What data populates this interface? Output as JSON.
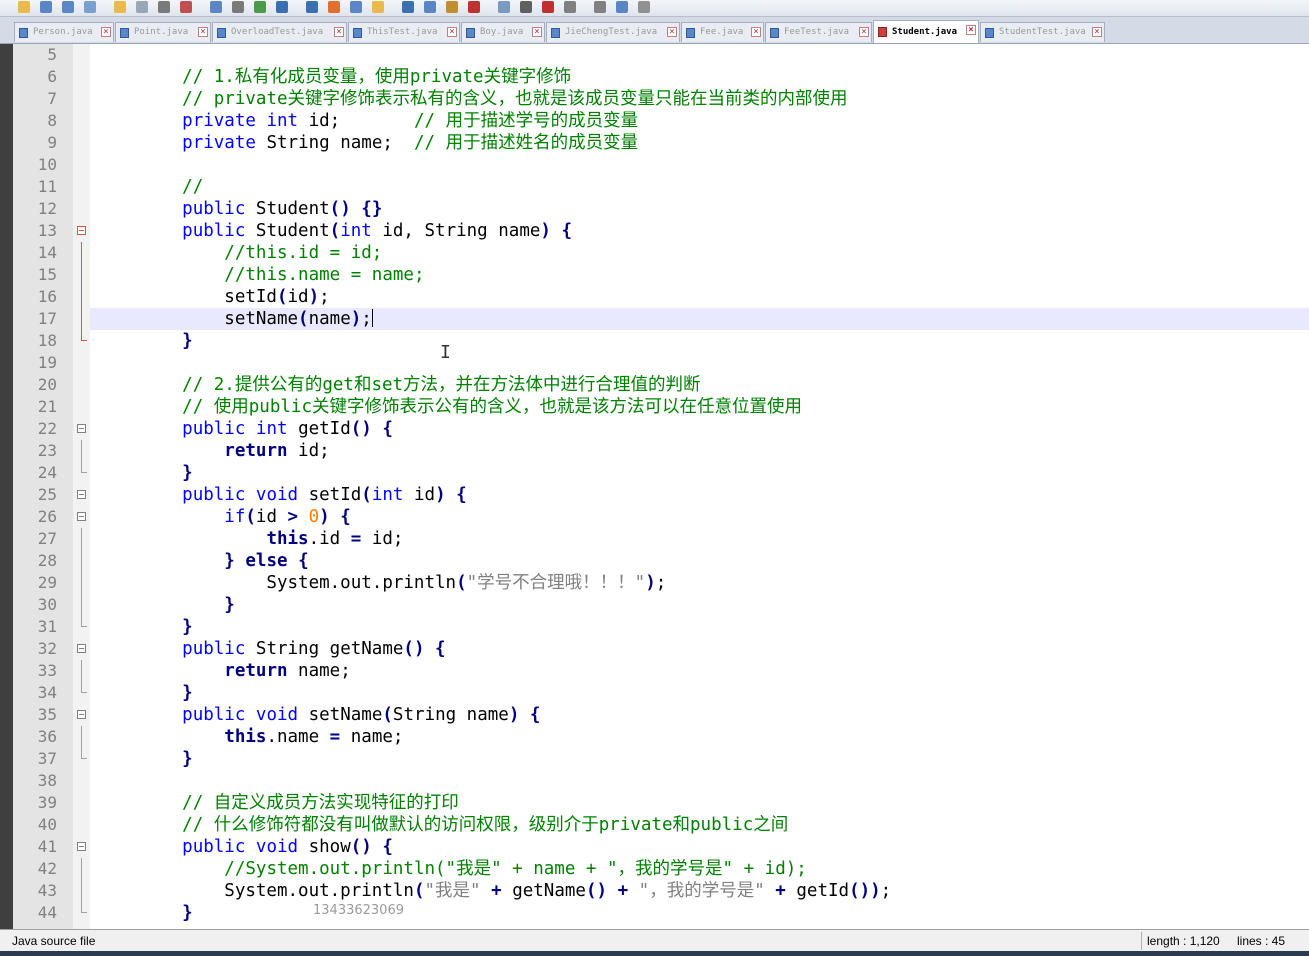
{
  "tabs": [
    {
      "label": "Person.java",
      "active": false
    },
    {
      "label": "Point.java",
      "active": false
    },
    {
      "label": "OverloadTest.java",
      "active": false
    },
    {
      "label": "ThisTest.java",
      "active": false
    },
    {
      "label": "Boy.java",
      "active": false
    },
    {
      "label": "JieChengTest.java",
      "active": false
    },
    {
      "label": "Fee.java",
      "active": false
    },
    {
      "label": "FeeTest.java",
      "active": false
    },
    {
      "label": "Student.java",
      "active": true
    },
    {
      "label": "StudentTest.java",
      "active": false
    }
  ],
  "editor": {
    "current_line": 17,
    "lines": [
      {
        "n": 5,
        "t": [
          [
            "",
            "    "
          ]
        ]
      },
      {
        "n": 6,
        "t": [
          [
            "",
            "    "
          ],
          [
            "c",
            "// 1.私有化成员变量，使用private关键字修饰"
          ]
        ]
      },
      {
        "n": 7,
        "t": [
          [
            "",
            "    "
          ],
          [
            "c",
            "// private关键字修饰表示私有的含义，也就是该成员变量只能在当前类的内部使用"
          ]
        ]
      },
      {
        "n": 8,
        "t": [
          [
            "",
            "    "
          ],
          [
            "k",
            "private"
          ],
          [
            "",
            " "
          ],
          [
            "k",
            "int"
          ],
          [
            "",
            " id;       "
          ],
          [
            "c",
            "// 用于描述学号的成员变量"
          ]
        ]
      },
      {
        "n": 9,
        "t": [
          [
            "",
            "    "
          ],
          [
            "k",
            "private"
          ],
          [
            "",
            " String name;  "
          ],
          [
            "c",
            "// 用于描述姓名的成员变量"
          ]
        ]
      },
      {
        "n": 10,
        "t": [
          [
            "",
            "    "
          ]
        ]
      },
      {
        "n": 11,
        "t": [
          [
            "",
            "    "
          ],
          [
            "c",
            "//"
          ]
        ]
      },
      {
        "n": 12,
        "t": [
          [
            "",
            "    "
          ],
          [
            "k",
            "public"
          ],
          [
            "",
            " Student"
          ],
          [
            "o",
            "()"
          ],
          [
            "",
            " "
          ],
          [
            "o",
            "{}"
          ]
        ]
      },
      {
        "n": 13,
        "t": [
          [
            "",
            "    "
          ],
          [
            "k",
            "public"
          ],
          [
            "",
            " Student"
          ],
          [
            "o",
            "("
          ],
          [
            "k",
            "int"
          ],
          [
            "",
            " id, String name"
          ],
          [
            "o",
            ")"
          ],
          [
            "",
            " "
          ],
          [
            "o",
            "{"
          ]
        ]
      },
      {
        "n": 14,
        "t": [
          [
            "",
            "        "
          ],
          [
            "c",
            "//this.id = id;"
          ]
        ]
      },
      {
        "n": 15,
        "t": [
          [
            "",
            "        "
          ],
          [
            "c",
            "//this.name = name;"
          ]
        ]
      },
      {
        "n": 16,
        "t": [
          [
            "",
            "        setId"
          ],
          [
            "o",
            "("
          ],
          [
            "",
            "id"
          ],
          [
            "o",
            ")"
          ],
          [
            "",
            ";"
          ]
        ]
      },
      {
        "n": 17,
        "t": [
          [
            "",
            "        setName"
          ],
          [
            "o",
            "("
          ],
          [
            "",
            "name"
          ],
          [
            "o",
            ")"
          ],
          [
            "",
            ";"
          ]
        ]
      },
      {
        "n": 18,
        "t": [
          [
            "",
            "    "
          ],
          [
            "o",
            "}"
          ]
        ]
      },
      {
        "n": 19,
        "t": [
          [
            "",
            "    "
          ]
        ]
      },
      {
        "n": 20,
        "t": [
          [
            "",
            "    "
          ],
          [
            "c",
            "// 2.提供公有的get和set方法，并在方法体中进行合理值的判断"
          ]
        ]
      },
      {
        "n": 21,
        "t": [
          [
            "",
            "    "
          ],
          [
            "c",
            "// 使用public关键字修饰表示公有的含义，也就是该方法可以在任意位置使用"
          ]
        ]
      },
      {
        "n": 22,
        "t": [
          [
            "",
            "    "
          ],
          [
            "k",
            "public"
          ],
          [
            "",
            " "
          ],
          [
            "k",
            "int"
          ],
          [
            "",
            " getId"
          ],
          [
            "o",
            "()"
          ],
          [
            "",
            " "
          ],
          [
            "o",
            "{"
          ]
        ]
      },
      {
        "n": 23,
        "t": [
          [
            "",
            "        "
          ],
          [
            "kb",
            "return"
          ],
          [
            "",
            " id;"
          ]
        ]
      },
      {
        "n": 24,
        "t": [
          [
            "",
            "    "
          ],
          [
            "o",
            "}"
          ]
        ]
      },
      {
        "n": 25,
        "t": [
          [
            "",
            "    "
          ],
          [
            "k",
            "public"
          ],
          [
            "",
            " "
          ],
          [
            "k",
            "void"
          ],
          [
            "",
            " setId"
          ],
          [
            "o",
            "("
          ],
          [
            "k",
            "int"
          ],
          [
            "",
            " id"
          ],
          [
            "o",
            ")"
          ],
          [
            "",
            " "
          ],
          [
            "o",
            "{"
          ]
        ]
      },
      {
        "n": 26,
        "t": [
          [
            "",
            "        "
          ],
          [
            "k",
            "if"
          ],
          [
            "o",
            "("
          ],
          [
            "",
            "id "
          ],
          [
            "o",
            ">"
          ],
          [
            "",
            " "
          ],
          [
            "n",
            "0"
          ],
          [
            "o",
            ")"
          ],
          [
            "",
            " "
          ],
          [
            "o",
            "{"
          ]
        ]
      },
      {
        "n": 27,
        "t": [
          [
            "",
            "            "
          ],
          [
            "kb",
            "this"
          ],
          [
            "",
            ".id "
          ],
          [
            "o",
            "="
          ],
          [
            "",
            " id;"
          ]
        ]
      },
      {
        "n": 28,
        "t": [
          [
            "",
            "        "
          ],
          [
            "o",
            "}"
          ],
          [
            "",
            " "
          ],
          [
            "kb",
            "else"
          ],
          [
            "",
            " "
          ],
          [
            "o",
            "{"
          ]
        ]
      },
      {
        "n": 29,
        "t": [
          [
            "",
            "            System.out.println"
          ],
          [
            "o",
            "("
          ],
          [
            "s",
            "\"学号不合理哦！！！\""
          ],
          [
            "o",
            ")"
          ],
          [
            "",
            ";"
          ]
        ]
      },
      {
        "n": 30,
        "t": [
          [
            "",
            "        "
          ],
          [
            "o",
            "}"
          ]
        ]
      },
      {
        "n": 31,
        "t": [
          [
            "",
            "    "
          ],
          [
            "o",
            "}"
          ]
        ]
      },
      {
        "n": 32,
        "t": [
          [
            "",
            "    "
          ],
          [
            "k",
            "public"
          ],
          [
            "",
            " String getName"
          ],
          [
            "o",
            "()"
          ],
          [
            "",
            " "
          ],
          [
            "o",
            "{"
          ]
        ]
      },
      {
        "n": 33,
        "t": [
          [
            "",
            "        "
          ],
          [
            "kb",
            "return"
          ],
          [
            "",
            " name;"
          ]
        ]
      },
      {
        "n": 34,
        "t": [
          [
            "",
            "    "
          ],
          [
            "o",
            "}"
          ]
        ]
      },
      {
        "n": 35,
        "t": [
          [
            "",
            "    "
          ],
          [
            "k",
            "public"
          ],
          [
            "",
            " "
          ],
          [
            "k",
            "void"
          ],
          [
            "",
            " setName"
          ],
          [
            "o",
            "("
          ],
          [
            "",
            "String name"
          ],
          [
            "o",
            ")"
          ],
          [
            "",
            " "
          ],
          [
            "o",
            "{"
          ]
        ]
      },
      {
        "n": 36,
        "t": [
          [
            "",
            "        "
          ],
          [
            "kb",
            "this"
          ],
          [
            "",
            ".name "
          ],
          [
            "o",
            "="
          ],
          [
            "",
            " name;"
          ]
        ]
      },
      {
        "n": 37,
        "t": [
          [
            "",
            "    "
          ],
          [
            "o",
            "}"
          ]
        ]
      },
      {
        "n": 38,
        "t": [
          [
            "",
            "    "
          ]
        ]
      },
      {
        "n": 39,
        "t": [
          [
            "",
            "    "
          ],
          [
            "c",
            "// 自定义成员方法实现特征的打印"
          ]
        ]
      },
      {
        "n": 40,
        "t": [
          [
            "",
            "    "
          ],
          [
            "c",
            "// 什么修饰符都没有叫做默认的访问权限，级别介于private和public之间"
          ]
        ]
      },
      {
        "n": 41,
        "t": [
          [
            "",
            "    "
          ],
          [
            "k",
            "public"
          ],
          [
            "",
            " "
          ],
          [
            "k",
            "void"
          ],
          [
            "",
            " show"
          ],
          [
            "o",
            "()"
          ],
          [
            "",
            " "
          ],
          [
            "o",
            "{"
          ]
        ]
      },
      {
        "n": 42,
        "t": [
          [
            "",
            "        "
          ],
          [
            "c",
            "//System.out.println(\"我是\" + name + \"，我的学号是\" + id);"
          ]
        ]
      },
      {
        "n": 43,
        "t": [
          [
            "",
            "        System.out.println"
          ],
          [
            "o",
            "("
          ],
          [
            "s",
            "\"我是\""
          ],
          [
            "",
            " "
          ],
          [
            "o",
            "+"
          ],
          [
            "",
            " getName"
          ],
          [
            "o",
            "()"
          ],
          [
            "",
            " "
          ],
          [
            "o",
            "+"
          ],
          [
            "",
            " "
          ],
          [
            "s",
            "\"，我的学号是\""
          ],
          [
            "",
            " "
          ],
          [
            "o",
            "+"
          ],
          [
            "",
            " getId"
          ],
          [
            "o",
            "())"
          ],
          [
            "",
            ";"
          ]
        ]
      },
      {
        "n": 44,
        "t": [
          [
            "",
            "    "
          ],
          [
            "o",
            "}"
          ]
        ]
      }
    ],
    "fold_markers": {
      "13": "box-red",
      "14": "line-red",
      "15": "line-red",
      "16": "line-red",
      "17": "line-red",
      "18": "end-red",
      "22": "box",
      "23": "line",
      "24": "end",
      "25": "box",
      "26": "box",
      "27": "line",
      "28": "line",
      "29": "line",
      "30": "line",
      "31": "end",
      "32": "box",
      "33": "line",
      "34": "end",
      "35": "box",
      "36": "line",
      "37": "end",
      "41": "box",
      "42": "line",
      "43": "line",
      "44": "end"
    }
  },
  "watermark": "13433623069",
  "status": {
    "file_type": "Java source file",
    "length": "length : 1,120",
    "lines": "lines : 45"
  }
}
